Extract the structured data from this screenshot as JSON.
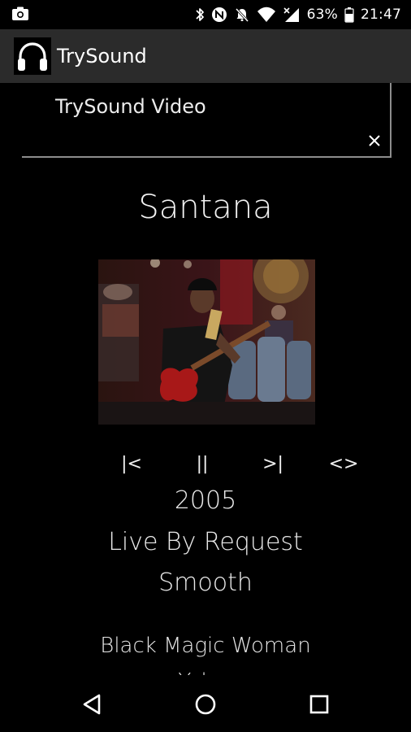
{
  "status_bar": {
    "battery_percent": "63%",
    "time": "21:47",
    "icons": [
      "camera-icon",
      "bluetooth-icon",
      "nfc-icon",
      "do-not-disturb-icon",
      "wifi-icon",
      "cellular-signal-icon",
      "battery-icon"
    ]
  },
  "app_bar": {
    "title": "TrySound",
    "logo_icon": "headphones-icon"
  },
  "video_banner": {
    "title": "TrySound Video",
    "close_icon": "close-icon"
  },
  "now_playing": {
    "artist": "Santana",
    "year": "2005",
    "album": "Live By Request",
    "track": "Smooth"
  },
  "controls": {
    "previous_label": "|<",
    "pause_label": "||",
    "next_label": ">|",
    "toggle_label": "<>"
  },
  "playlist": {
    "items": [
      "Black Magic Woman",
      "Yaleo"
    ]
  },
  "nav_bar": {
    "icons": [
      "back-icon",
      "home-icon",
      "recents-icon"
    ]
  },
  "colors": {
    "background": "#000000",
    "app_bar": "#2b2b2b",
    "banner_border": "#8d8d8d",
    "text": "#ffffff"
  }
}
